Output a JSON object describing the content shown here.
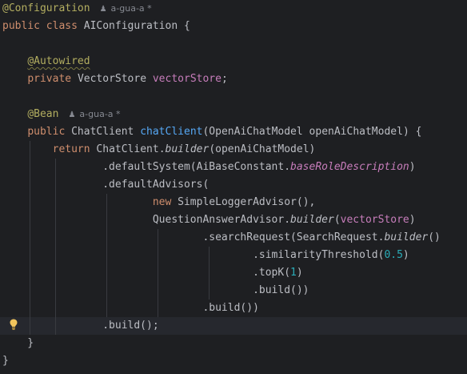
{
  "editor": {
    "lines": [
      {
        "tokens": [
          {
            "t": "@Configuration",
            "c": "ann"
          }
        ],
        "author": "a-gua-a *"
      },
      {
        "tokens": [
          {
            "t": "public class ",
            "c": "kw"
          },
          {
            "t": "AIConfiguration {",
            "c": ""
          }
        ]
      },
      {
        "tokens": []
      },
      {
        "tokens": [
          {
            "t": "    "
          },
          {
            "t": "@Autowired",
            "c": "ann-wavy"
          }
        ]
      },
      {
        "tokens": [
          {
            "t": "    "
          },
          {
            "t": "private ",
            "c": "kw"
          },
          {
            "t": "VectorStore "
          },
          {
            "t": "vectorStore",
            "c": "field"
          },
          {
            "t": ";"
          }
        ]
      },
      {
        "tokens": []
      },
      {
        "tokens": [
          {
            "t": "    "
          },
          {
            "t": "@Bean",
            "c": "ann"
          }
        ],
        "author": "a-gua-a *"
      },
      {
        "tokens": [
          {
            "t": "    "
          },
          {
            "t": "public ",
            "c": "kw"
          },
          {
            "t": "ChatClient "
          },
          {
            "t": "chatClient",
            "c": "method"
          },
          {
            "t": "(OpenAiChatModel openAiChatModel) {"
          }
        ]
      },
      {
        "tokens": [
          {
            "t": "        "
          },
          {
            "t": "return ",
            "c": "kw"
          },
          {
            "t": "ChatClient."
          },
          {
            "t": "builder",
            "c": "italic"
          },
          {
            "t": "(openAiChatModel)"
          }
        ]
      },
      {
        "tokens": [
          {
            "t": "                .defaultSystem(AiBaseConstant."
          },
          {
            "t": "baseRoleDescription",
            "c": "static-field"
          },
          {
            "t": ")"
          }
        ]
      },
      {
        "tokens": [
          {
            "t": "                .defaultAdvisors("
          }
        ]
      },
      {
        "tokens": [
          {
            "t": "                        "
          },
          {
            "t": "new ",
            "c": "kw"
          },
          {
            "t": "SimpleLoggerAdvisor(),"
          }
        ]
      },
      {
        "tokens": [
          {
            "t": "                        QuestionAnswerAdvisor."
          },
          {
            "t": "builder",
            "c": "italic"
          },
          {
            "t": "("
          },
          {
            "t": "vectorStore",
            "c": "field"
          },
          {
            "t": ")"
          }
        ]
      },
      {
        "tokens": [
          {
            "t": "                                .searchRequest(SearchRequest."
          },
          {
            "t": "builder",
            "c": "italic"
          },
          {
            "t": "()"
          }
        ]
      },
      {
        "tokens": [
          {
            "t": "                                        .similarityThreshold("
          },
          {
            "t": "0.5",
            "c": "num"
          },
          {
            "t": ")"
          }
        ]
      },
      {
        "tokens": [
          {
            "t": "                                        .topK("
          },
          {
            "t": "1",
            "c": "num"
          },
          {
            "t": ")"
          }
        ]
      },
      {
        "tokens": [
          {
            "t": "                                        .build())"
          }
        ]
      },
      {
        "tokens": [
          {
            "t": "                                .build())"
          }
        ]
      },
      {
        "tokens": [
          {
            "t": "                .build();"
          }
        ],
        "current": true
      },
      {
        "tokens": [
          {
            "t": "    }"
          }
        ]
      },
      {
        "tokens": [
          {
            "t": "}"
          }
        ]
      }
    ],
    "intention_icon": "lightbulb-icon",
    "author_icon": "person-icon"
  }
}
